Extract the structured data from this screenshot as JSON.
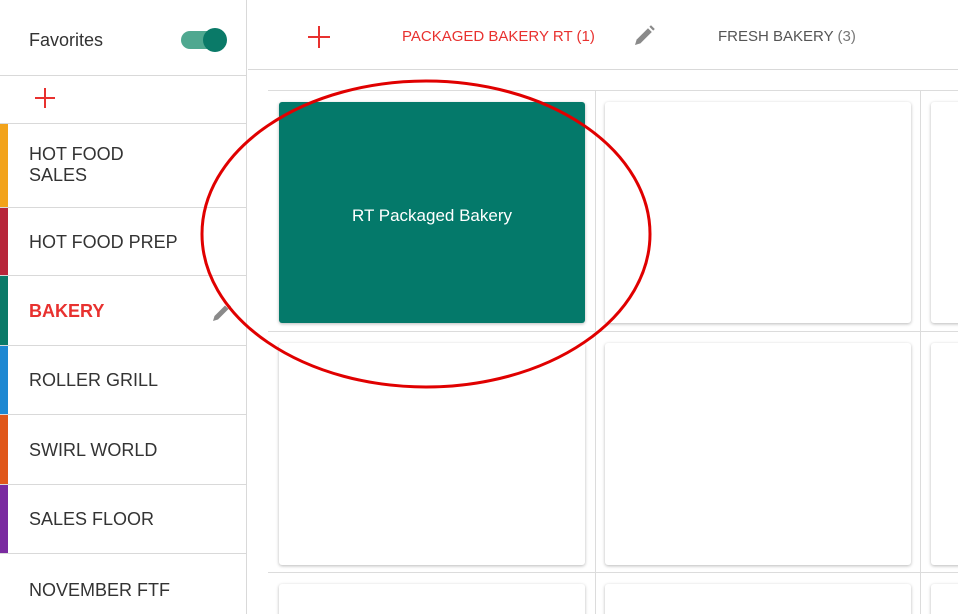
{
  "sidebar": {
    "favorites_label": "Favorites",
    "favorites_enabled": true,
    "items": [
      {
        "label": "HOT FOOD SALES",
        "color": "#f2a31b"
      },
      {
        "label": "HOT FOOD PREP",
        "color": "#b7263a"
      },
      {
        "label": "BAKERY",
        "color": "#0a7a68",
        "active": true
      },
      {
        "label": "ROLLER GRILL",
        "color": "#1e88d2"
      },
      {
        "label": "SWIRL WORLD",
        "color": "#e0571a"
      },
      {
        "label": "SALES FLOOR",
        "color": "#7a2aa0"
      },
      {
        "label": "NOVEMBER FTF",
        "color": ""
      }
    ]
  },
  "tabs": [
    {
      "name": "PACKAGED BAKERY RT",
      "count": "(1)",
      "active": true
    },
    {
      "name": "FRESH BAKERY",
      "count": "(3)",
      "active": false
    }
  ],
  "grid": {
    "tiles": [
      {
        "label": "RT Packaged Bakery",
        "color": "#04796a"
      }
    ]
  },
  "colors": {
    "accent": "#e8312f",
    "tile_fill": "#04796a",
    "annotation": "#e00000"
  }
}
